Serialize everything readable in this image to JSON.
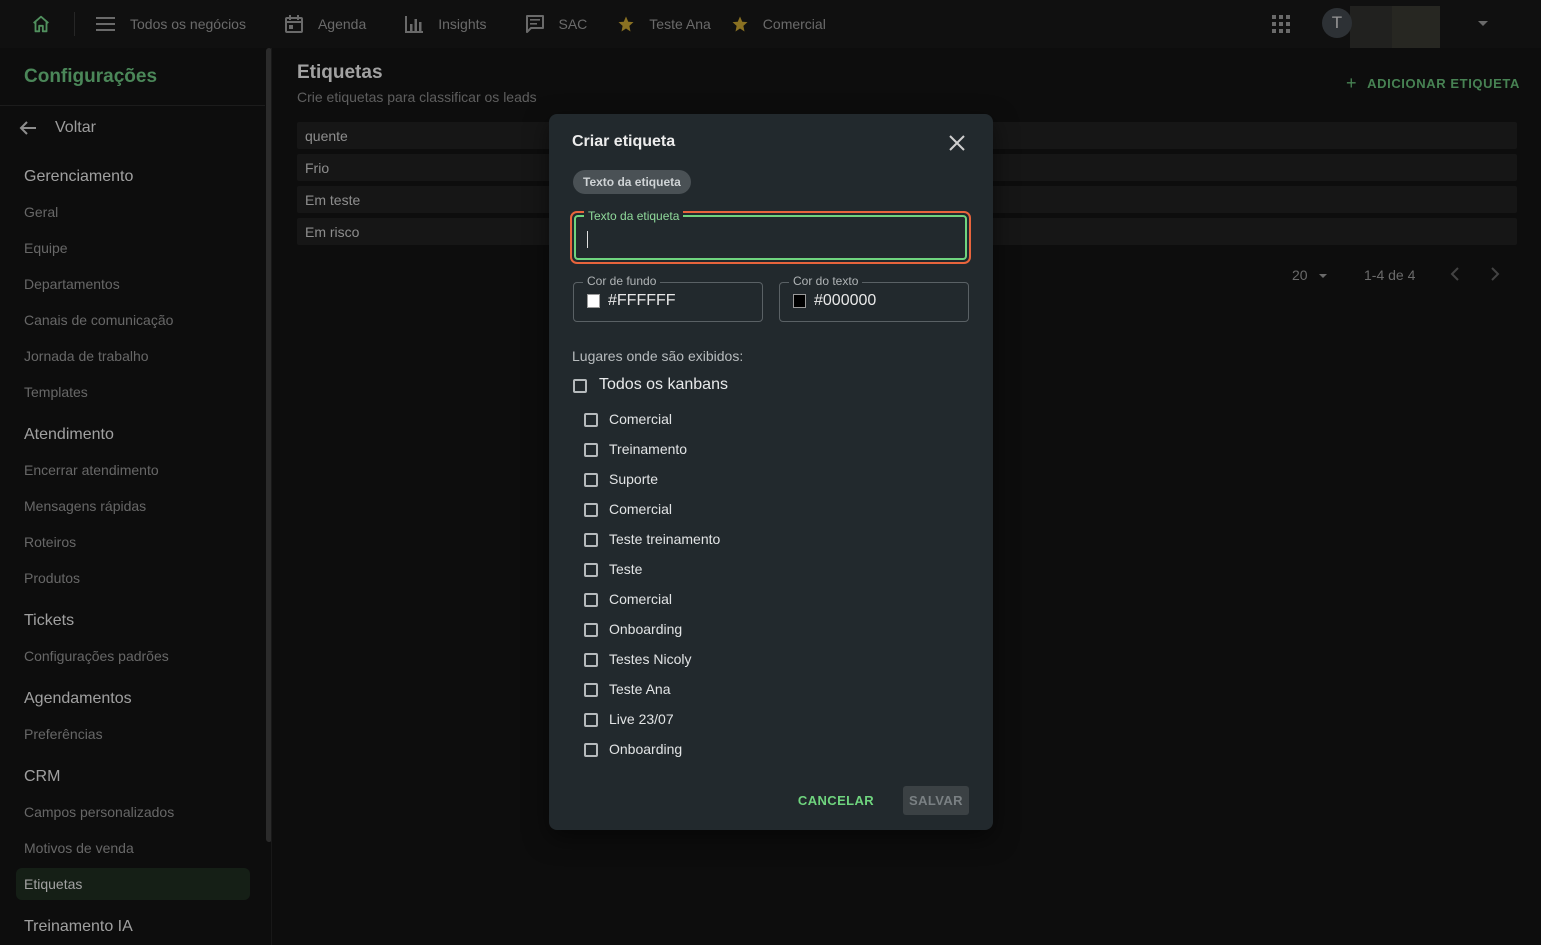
{
  "topbar": {
    "nav": [
      {
        "label": "Todos os negócios",
        "icon": "menu-lines-icon"
      },
      {
        "label": "Agenda",
        "icon": "calendar-icon"
      },
      {
        "label": "Insights",
        "icon": "bar-chart-icon"
      },
      {
        "label": "SAC",
        "icon": "chat-icon"
      },
      {
        "label": "Teste Ana",
        "icon": "star-icon"
      },
      {
        "label": "Comercial",
        "icon": "star-icon"
      }
    ],
    "avatar_letter": "T"
  },
  "sidebar": {
    "title": "Configurações",
    "back_label": "Voltar",
    "sections": [
      {
        "title": "Gerenciamento",
        "items": [
          "Geral",
          "Equipe",
          "Departamentos",
          "Canais de comunicação",
          "Jornada de trabalho",
          "Templates"
        ]
      },
      {
        "title": "Atendimento",
        "items": [
          "Encerrar atendimento",
          "Mensagens rápidas",
          "Roteiros",
          "Produtos"
        ]
      },
      {
        "title": "Tickets",
        "items": [
          "Configurações padrões"
        ]
      },
      {
        "title": "Agendamentos",
        "items": [
          "Preferências"
        ]
      },
      {
        "title": "CRM",
        "items": [
          "Campos personalizados",
          "Motivos de venda",
          "Etiquetas"
        ]
      },
      {
        "title": "Treinamento IA",
        "items": []
      }
    ],
    "active_item": "Etiquetas"
  },
  "main": {
    "title": "Etiquetas",
    "subtitle": "Crie etiquetas para classificar os leads",
    "add_button": "ADICIONAR ETIQUETA",
    "rows": [
      "quente",
      "Frio",
      "Em teste",
      "Em risco"
    ],
    "pagination": {
      "per_page": "20",
      "range": "1-4 de 4"
    }
  },
  "modal": {
    "title": "Criar etiqueta",
    "chip_label": "Texto da etiqueta",
    "text_field": {
      "label": "Texto da etiqueta",
      "value": ""
    },
    "bg_color": {
      "label": "Cor de fundo",
      "value": "#FFFFFF"
    },
    "text_color": {
      "label": "Cor do texto",
      "value": "#000000"
    },
    "places_label": "Lugares onde são exibidos:",
    "all_kanbans_label": "Todos os kanbans",
    "kanbans": [
      "Comercial",
      "Treinamento",
      "Suporte",
      "Comercial",
      "Teste treinamento",
      "Teste",
      "Comercial",
      "Onboarding",
      "Testes Nicoly",
      "Teste Ana",
      "Live 23/07",
      "Onboarding"
    ],
    "cancel_label": "CANCELAR",
    "save_label": "SALVAR"
  },
  "colors": {
    "accent": "#64b577",
    "focus_outline": "#e8643c",
    "field_focus": "#6fd47e"
  }
}
